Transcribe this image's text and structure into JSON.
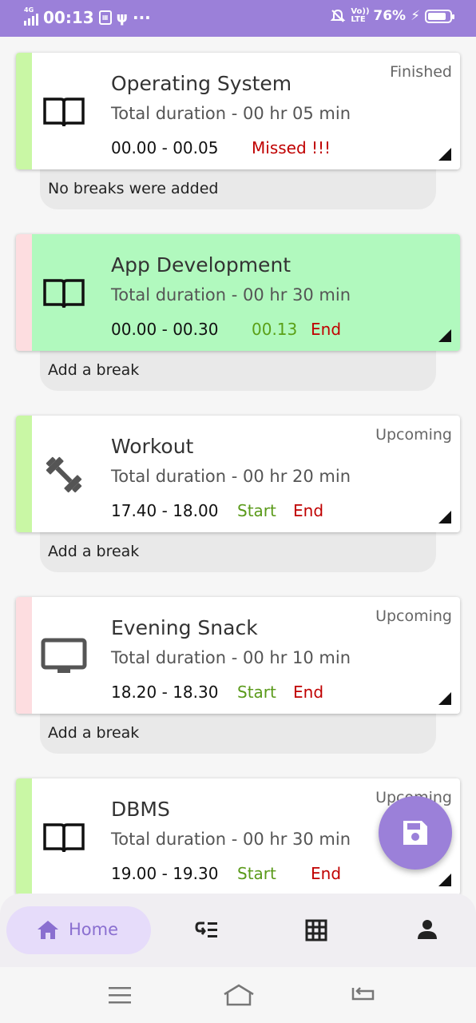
{
  "status_bar": {
    "time": "00:13",
    "network": "4G",
    "volte": "Vo)) LTE",
    "battery": "76%",
    "dots": "···"
  },
  "tasks": [
    {
      "title": "Operating System",
      "duration": "Total duration - 00 hr 05 min",
      "time_range": "00.00 - 00.05",
      "status": "Finished",
      "missed_label": "Missed !!!",
      "break_text": "No breaks were added",
      "icon": "book-icon",
      "stripe": "#c9f7a5"
    },
    {
      "title": "App Development",
      "duration": "Total duration - 00 hr 30 min",
      "time_range": "00.00 - 00.30",
      "elapsed": "00.13",
      "end_label": "End",
      "break_text": "Add a break",
      "icon": "book-icon",
      "stripe": "#fddde0",
      "background": "#b1f9be"
    },
    {
      "title": "Workout",
      "duration": "Total duration - 00 hr 20 min",
      "time_range": "17.40 - 18.00",
      "status": "Upcoming",
      "start_label": "Start",
      "end_label": "End",
      "break_text": "Add a break",
      "icon": "dumbbell-icon",
      "stripe": "#c9f7a5"
    },
    {
      "title": "Evening Snack",
      "duration": "Total duration - 00 hr 10 min",
      "time_range": "18.20 - 18.30",
      "status": "Upcoming",
      "start_label": "Start",
      "end_label": "End",
      "break_text": "Add a break",
      "icon": "tv-icon",
      "stripe": "#fddde0"
    },
    {
      "title": "DBMS",
      "duration": "Total duration - 00 hr 30 min",
      "time_range": "19.00 - 19.30",
      "status": "Upcoming",
      "start_label": "Start",
      "end_label": "End",
      "icon": "book-icon",
      "stripe": "#c9f7a5"
    }
  ],
  "fab": {
    "icon": "save-icon"
  },
  "bottom_nav": {
    "home_label": "Home",
    "items": [
      "home-icon",
      "task-list-icon",
      "grid-icon",
      "person-icon"
    ]
  },
  "colors": {
    "accent": "#9b80d9",
    "active_card": "#b1f9be",
    "missed": "#c00000",
    "start": "#5a9a1a"
  }
}
